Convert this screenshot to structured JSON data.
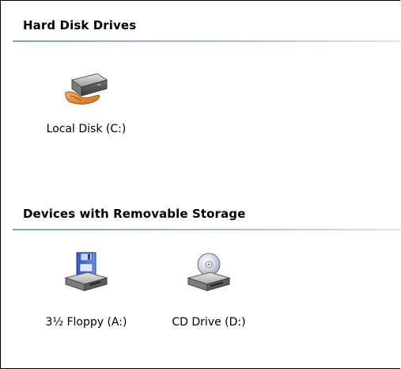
{
  "groups": [
    {
      "title": "Hard Disk Drives",
      "items": [
        {
          "label": "Local Disk (C:)",
          "icon": "hard-disk-icon"
        }
      ]
    },
    {
      "title": "Devices with Removable Storage",
      "items": [
        {
          "label": "3½ Floppy (A:)",
          "icon": "floppy-drive-icon"
        },
        {
          "label": "CD Drive (D:)",
          "icon": "cd-drive-icon"
        }
      ]
    }
  ],
  "colors": {
    "header_rule": "#7ea0d6",
    "drive_body": "#8c8c8c",
    "floppy_blue": "#3f6fcf",
    "disc_silver": "#dcdcdc"
  }
}
